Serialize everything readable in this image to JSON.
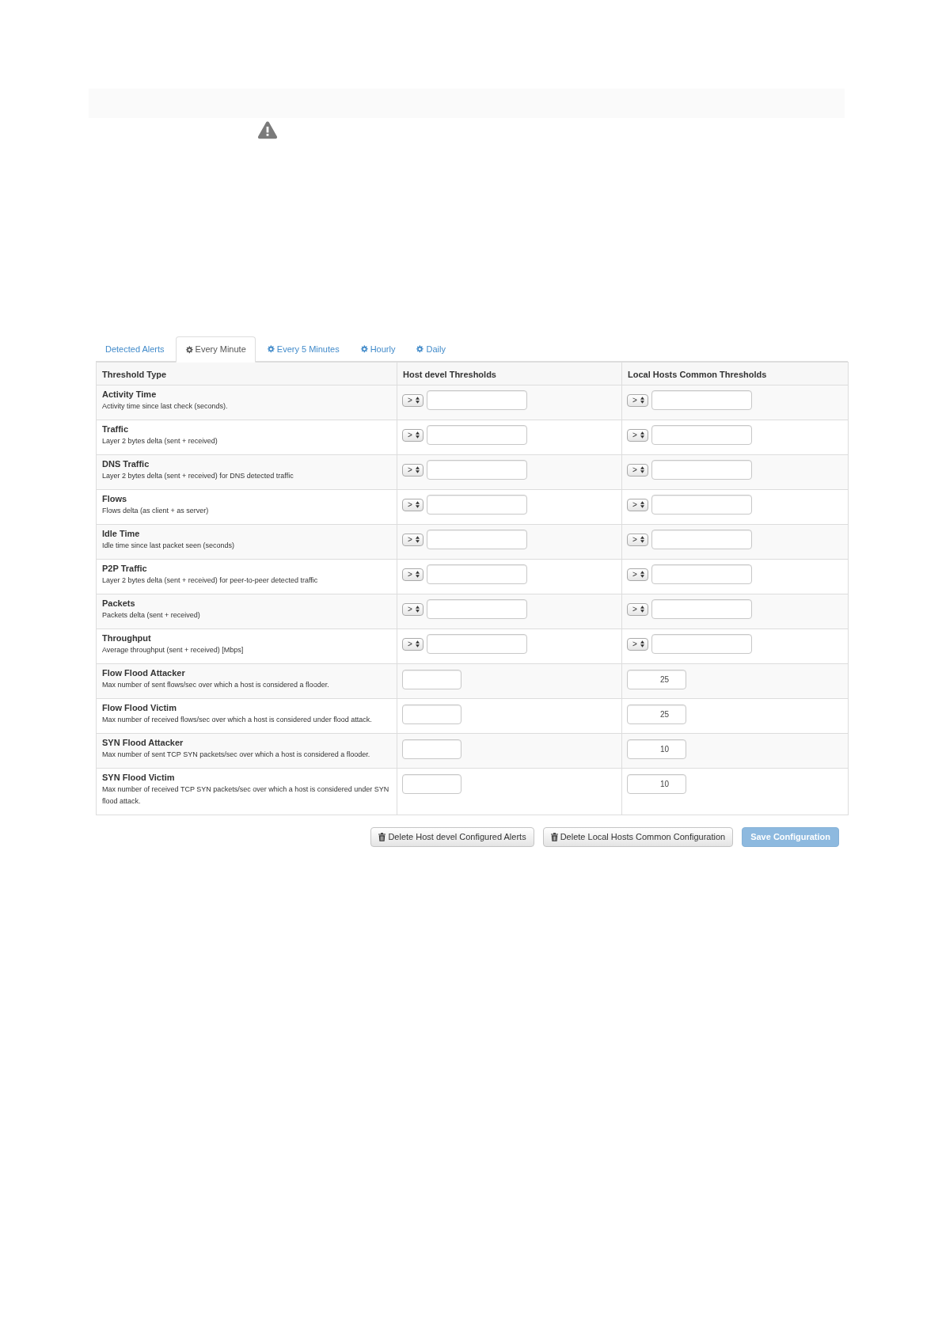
{
  "tabs": [
    {
      "label": "Detected Alerts",
      "kind": "alerts",
      "selected": false
    },
    {
      "label": "Every Minute",
      "kind": "schedule",
      "selected": true
    },
    {
      "label": "Every 5 Minutes",
      "kind": "schedule",
      "selected": false
    },
    {
      "label": "Hourly",
      "kind": "schedule",
      "selected": false
    },
    {
      "label": "Daily",
      "kind": "schedule",
      "selected": false
    }
  ],
  "table": {
    "columns": [
      "Threshold Type",
      "Host devel Thresholds",
      "Local Hosts Common Thresholds"
    ],
    "rows": [
      {
        "cells": [
          {
            "kind": "label",
            "title": "Activity Time",
            "description": "Activity time since last check (seconds)."
          },
          {
            "kind": "operator",
            "operator": ">"
          },
          {
            "kind": "operator",
            "operator": ">"
          }
        ]
      },
      {
        "cells": [
          {
            "kind": "label",
            "title": "Traffic",
            "description": "Layer 2 bytes delta (sent + received)"
          },
          {
            "kind": "operator",
            "operator": ">"
          },
          {
            "kind": "operator",
            "operator": ">"
          }
        ]
      },
      {
        "cells": [
          {
            "kind": "label",
            "title": "DNS Traffic",
            "description": "Layer 2 bytes delta (sent + received) for DNS detected traffic"
          },
          {
            "kind": "operator",
            "operator": ">"
          },
          {
            "kind": "operator",
            "operator": ">"
          }
        ]
      },
      {
        "cells": [
          {
            "kind": "label",
            "title": "Flows",
            "description": "Flows delta (as client + as server)"
          },
          {
            "kind": "operator",
            "operator": ">"
          },
          {
            "kind": "operator",
            "operator": ">"
          }
        ]
      },
      {
        "cells": [
          {
            "kind": "label",
            "title": "Idle Time",
            "description": "Idle time since last packet seen (seconds)"
          },
          {
            "kind": "operator",
            "operator": ">"
          },
          {
            "kind": "operator",
            "operator": ">"
          }
        ]
      },
      {
        "cells": [
          {
            "kind": "label",
            "title": "P2P Traffic",
            "description": "Layer 2 bytes delta (sent + received) for peer-to-peer detected traffic"
          },
          {
            "kind": "operator",
            "operator": ">"
          },
          {
            "kind": "operator",
            "operator": ">"
          }
        ]
      },
      {
        "cells": [
          {
            "kind": "label",
            "title": "Packets",
            "description": "Packets delta (sent + received)"
          },
          {
            "kind": "operator",
            "operator": ">"
          },
          {
            "kind": "operator",
            "operator": ">"
          }
        ]
      },
      {
        "cells": [
          {
            "kind": "label",
            "title": "Throughput",
            "description": "Average throughput (sent + received) [Mbps]"
          },
          {
            "kind": "operator",
            "operator": ">"
          },
          {
            "kind": "operator",
            "operator": ">"
          }
        ]
      },
      {
        "cells": [
          {
            "kind": "label",
            "title": "Flow Flood Attacker",
            "description": "Max number of sent flows/sec over which a host is considered a flooder."
          },
          {
            "kind": "number"
          },
          {
            "kind": "number",
            "value": "25"
          }
        ]
      },
      {
        "cells": [
          {
            "kind": "label",
            "title": "Flow Flood Victim",
            "description": "Max number of received flows/sec over which a host is considered under flood attack."
          },
          {
            "kind": "number"
          },
          {
            "kind": "number",
            "value": "25"
          }
        ]
      },
      {
        "cells": [
          {
            "kind": "label",
            "title": "SYN Flood Attacker",
            "description": "Max number of sent TCP SYN packets/sec over which a host is considered a flooder."
          },
          {
            "kind": "number"
          },
          {
            "kind": "number",
            "value": "10"
          }
        ]
      },
      {
        "cells": [
          {
            "kind": "label",
            "title": "SYN Flood Victim",
            "description": "Max number of received TCP SYN packets/sec over which a host is considered under SYN flood attack."
          },
          {
            "kind": "number"
          },
          {
            "kind": "number",
            "value": "10"
          }
        ]
      }
    ]
  },
  "buttons": [
    {
      "label": "Delete Host devel Configured Alerts",
      "kind": "delete",
      "disabled": false
    },
    {
      "label": "Delete Local Hosts Common Configuration",
      "kind": "delete",
      "disabled": false
    },
    {
      "label": "Save Configuration",
      "kind": "save",
      "disabled": true
    }
  ]
}
